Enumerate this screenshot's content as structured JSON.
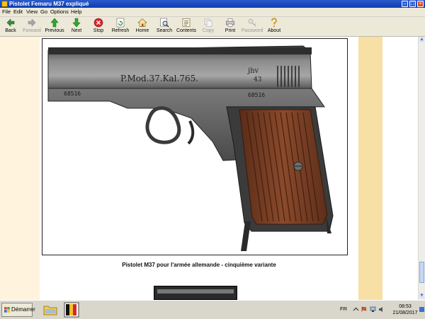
{
  "window": {
    "title": "Pistolet Femaru M37 expliqué"
  },
  "menu": [
    {
      "label": "File"
    },
    {
      "label": "Edit"
    },
    {
      "label": "View"
    },
    {
      "label": "Go"
    },
    {
      "label": "Options"
    },
    {
      "label": "Help"
    }
  ],
  "toolbar": {
    "back": {
      "label": "Back",
      "icon": "arrow-left-icon"
    },
    "forward": {
      "label": "Forward",
      "icon": "arrow-right-icon",
      "disabled": true
    },
    "previous": {
      "label": "Previous",
      "icon": "arrow-up-icon"
    },
    "next": {
      "label": "Next",
      "icon": "arrow-down-icon"
    },
    "stop": {
      "label": "Stop",
      "icon": "stop-icon"
    },
    "refresh": {
      "label": "Refresh",
      "icon": "refresh-icon"
    },
    "home": {
      "label": "Home",
      "icon": "home-icon"
    },
    "search": {
      "label": "Search",
      "icon": "search-icon"
    },
    "contents": {
      "label": "Contents",
      "icon": "contents-icon"
    },
    "copy": {
      "label": "Copy",
      "icon": "copy-icon",
      "disabled": true
    },
    "print": {
      "label": "Print",
      "icon": "print-icon"
    },
    "password": {
      "label": "Password",
      "icon": "key-icon",
      "disabled": true
    },
    "about": {
      "label": "About",
      "icon": "question-icon"
    }
  },
  "content": {
    "figure_engraving": {
      "line1": "P.Mod.37.Kal.765.",
      "serial": "68516",
      "mark": "jhv",
      "mark_year": "43"
    },
    "caption": "Pistolet M37 pour l'armée allemande - cinquième variante"
  },
  "taskbar": {
    "start_label": "Démarrer",
    "language": "FR",
    "time": "08:53",
    "date": "21/08/2017"
  },
  "colors": {
    "title_blue": "#0a3fb4",
    "left_panel": "#fff3dd",
    "right_panel": "#f8dfa4"
  }
}
